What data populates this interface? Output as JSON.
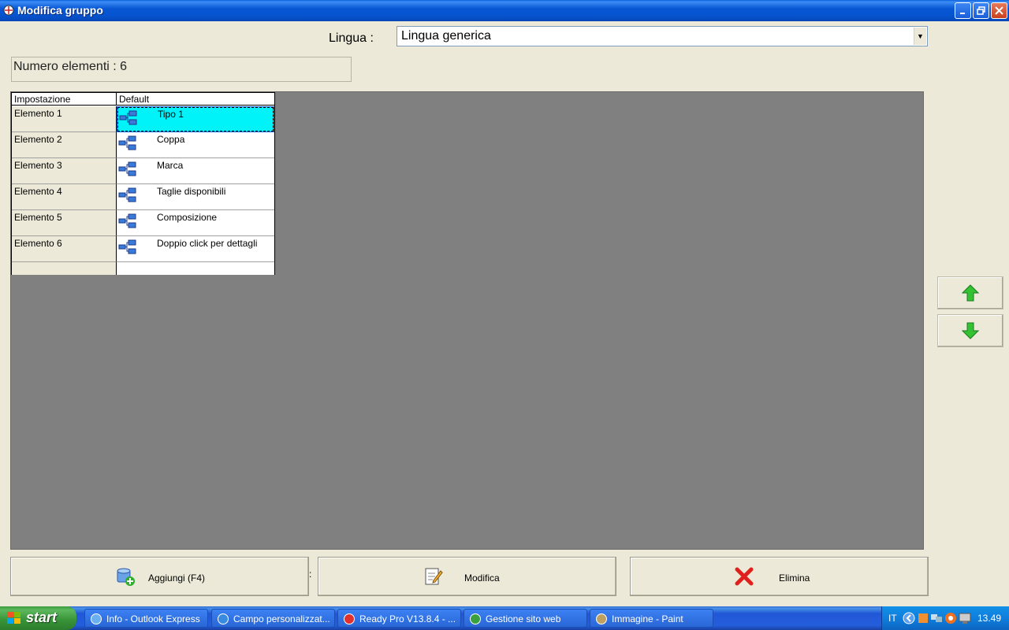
{
  "window": {
    "title": "Modifica gruppo"
  },
  "language": {
    "label": "Lingua :",
    "selected": "Lingua generica"
  },
  "count": {
    "text": "Numero elementi : 6"
  },
  "grid": {
    "headers": [
      "Impostazione",
      "Default"
    ],
    "rows": [
      {
        "key": "Elemento 1",
        "value": "Tipo 1",
        "selected": true
      },
      {
        "key": "Elemento 2",
        "value": "Coppa",
        "selected": false
      },
      {
        "key": "Elemento 3",
        "value": "Marca",
        "selected": false
      },
      {
        "key": "Elemento 4",
        "value": "Taglie disponibili",
        "selected": false
      },
      {
        "key": "Elemento 5",
        "value": "Composizione",
        "selected": false
      },
      {
        "key": "Elemento 6",
        "value": "Doppio click per dettagli",
        "selected": false
      }
    ],
    "selected_color": "#00f3f8"
  },
  "buttons": {
    "add": "Aggiungi (F4)",
    "edit": "Modifica",
    "delete": "Elimina"
  },
  "taskbar": {
    "start": "start",
    "tasks": [
      {
        "label": "Info - Outlook Express",
        "icon": "outlook-icon"
      },
      {
        "label": "Campo personalizzat...",
        "icon": "internet-explorer-icon"
      },
      {
        "label": "Ready Pro V13.8.4 - ...",
        "icon": "strawberry-icon"
      },
      {
        "label": "Gestione sito web",
        "icon": "globe-icon"
      },
      {
        "label": "Immagine - Paint",
        "icon": "paint-icon"
      }
    ],
    "tray": {
      "language": "IT",
      "clock": "13.49"
    }
  },
  "colors": {
    "titlebar": "#0a57d4",
    "window_bg": "#ece9d8",
    "grid_area_bg": "#808080",
    "arrow_green": "#34c234",
    "delete_red": "#e0201c"
  }
}
